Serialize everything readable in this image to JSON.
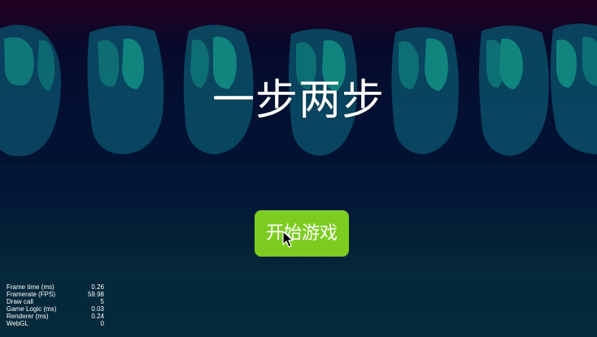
{
  "game": {
    "title": "一步两步",
    "start_button_label": "开始游戏"
  },
  "stats": [
    {
      "label": "Frame time (ms)",
      "value": "0.26"
    },
    {
      "label": "Framerate (FPS)",
      "value": "59.98"
    },
    {
      "label": "Draw call",
      "value": "5"
    },
    {
      "label": "Game Logic (ms)",
      "value": "0.03"
    },
    {
      "label": "Renderer (ms)",
      "value": "0.24"
    },
    {
      "label": "WebGL",
      "value": "0"
    }
  ],
  "colors": {
    "button": "#7ccd20",
    "pillar": "#0b5268",
    "pillar_glow": "#129a8c"
  }
}
